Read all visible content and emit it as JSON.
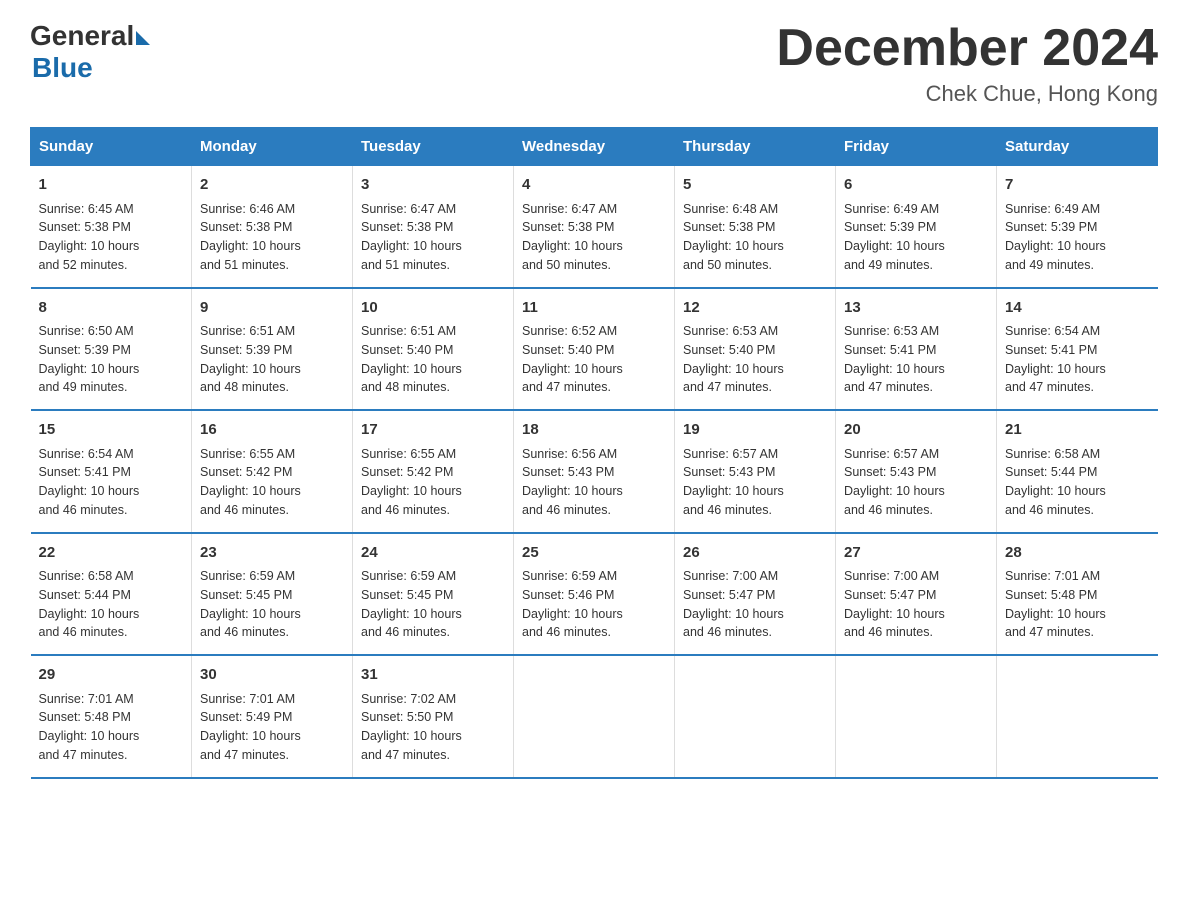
{
  "header": {
    "logo_general": "General",
    "logo_blue": "Blue",
    "main_title": "December 2024",
    "subtitle": "Chek Chue, Hong Kong"
  },
  "calendar": {
    "days_of_week": [
      "Sunday",
      "Monday",
      "Tuesday",
      "Wednesday",
      "Thursday",
      "Friday",
      "Saturday"
    ],
    "weeks": [
      [
        {
          "day": "1",
          "info": "Sunrise: 6:45 AM\nSunset: 5:38 PM\nDaylight: 10 hours\nand 52 minutes."
        },
        {
          "day": "2",
          "info": "Sunrise: 6:46 AM\nSunset: 5:38 PM\nDaylight: 10 hours\nand 51 minutes."
        },
        {
          "day": "3",
          "info": "Sunrise: 6:47 AM\nSunset: 5:38 PM\nDaylight: 10 hours\nand 51 minutes."
        },
        {
          "day": "4",
          "info": "Sunrise: 6:47 AM\nSunset: 5:38 PM\nDaylight: 10 hours\nand 50 minutes."
        },
        {
          "day": "5",
          "info": "Sunrise: 6:48 AM\nSunset: 5:38 PM\nDaylight: 10 hours\nand 50 minutes."
        },
        {
          "day": "6",
          "info": "Sunrise: 6:49 AM\nSunset: 5:39 PM\nDaylight: 10 hours\nand 49 minutes."
        },
        {
          "day": "7",
          "info": "Sunrise: 6:49 AM\nSunset: 5:39 PM\nDaylight: 10 hours\nand 49 minutes."
        }
      ],
      [
        {
          "day": "8",
          "info": "Sunrise: 6:50 AM\nSunset: 5:39 PM\nDaylight: 10 hours\nand 49 minutes."
        },
        {
          "day": "9",
          "info": "Sunrise: 6:51 AM\nSunset: 5:39 PM\nDaylight: 10 hours\nand 48 minutes."
        },
        {
          "day": "10",
          "info": "Sunrise: 6:51 AM\nSunset: 5:40 PM\nDaylight: 10 hours\nand 48 minutes."
        },
        {
          "day": "11",
          "info": "Sunrise: 6:52 AM\nSunset: 5:40 PM\nDaylight: 10 hours\nand 47 minutes."
        },
        {
          "day": "12",
          "info": "Sunrise: 6:53 AM\nSunset: 5:40 PM\nDaylight: 10 hours\nand 47 minutes."
        },
        {
          "day": "13",
          "info": "Sunrise: 6:53 AM\nSunset: 5:41 PM\nDaylight: 10 hours\nand 47 minutes."
        },
        {
          "day": "14",
          "info": "Sunrise: 6:54 AM\nSunset: 5:41 PM\nDaylight: 10 hours\nand 47 minutes."
        }
      ],
      [
        {
          "day": "15",
          "info": "Sunrise: 6:54 AM\nSunset: 5:41 PM\nDaylight: 10 hours\nand 46 minutes."
        },
        {
          "day": "16",
          "info": "Sunrise: 6:55 AM\nSunset: 5:42 PM\nDaylight: 10 hours\nand 46 minutes."
        },
        {
          "day": "17",
          "info": "Sunrise: 6:55 AM\nSunset: 5:42 PM\nDaylight: 10 hours\nand 46 minutes."
        },
        {
          "day": "18",
          "info": "Sunrise: 6:56 AM\nSunset: 5:43 PM\nDaylight: 10 hours\nand 46 minutes."
        },
        {
          "day": "19",
          "info": "Sunrise: 6:57 AM\nSunset: 5:43 PM\nDaylight: 10 hours\nand 46 minutes."
        },
        {
          "day": "20",
          "info": "Sunrise: 6:57 AM\nSunset: 5:43 PM\nDaylight: 10 hours\nand 46 minutes."
        },
        {
          "day": "21",
          "info": "Sunrise: 6:58 AM\nSunset: 5:44 PM\nDaylight: 10 hours\nand 46 minutes."
        }
      ],
      [
        {
          "day": "22",
          "info": "Sunrise: 6:58 AM\nSunset: 5:44 PM\nDaylight: 10 hours\nand 46 minutes."
        },
        {
          "day": "23",
          "info": "Sunrise: 6:59 AM\nSunset: 5:45 PM\nDaylight: 10 hours\nand 46 minutes."
        },
        {
          "day": "24",
          "info": "Sunrise: 6:59 AM\nSunset: 5:45 PM\nDaylight: 10 hours\nand 46 minutes."
        },
        {
          "day": "25",
          "info": "Sunrise: 6:59 AM\nSunset: 5:46 PM\nDaylight: 10 hours\nand 46 minutes."
        },
        {
          "day": "26",
          "info": "Sunrise: 7:00 AM\nSunset: 5:47 PM\nDaylight: 10 hours\nand 46 minutes."
        },
        {
          "day": "27",
          "info": "Sunrise: 7:00 AM\nSunset: 5:47 PM\nDaylight: 10 hours\nand 46 minutes."
        },
        {
          "day": "28",
          "info": "Sunrise: 7:01 AM\nSunset: 5:48 PM\nDaylight: 10 hours\nand 47 minutes."
        }
      ],
      [
        {
          "day": "29",
          "info": "Sunrise: 7:01 AM\nSunset: 5:48 PM\nDaylight: 10 hours\nand 47 minutes."
        },
        {
          "day": "30",
          "info": "Sunrise: 7:01 AM\nSunset: 5:49 PM\nDaylight: 10 hours\nand 47 minutes."
        },
        {
          "day": "31",
          "info": "Sunrise: 7:02 AM\nSunset: 5:50 PM\nDaylight: 10 hours\nand 47 minutes."
        },
        {
          "day": "",
          "info": ""
        },
        {
          "day": "",
          "info": ""
        },
        {
          "day": "",
          "info": ""
        },
        {
          "day": "",
          "info": ""
        }
      ]
    ]
  }
}
